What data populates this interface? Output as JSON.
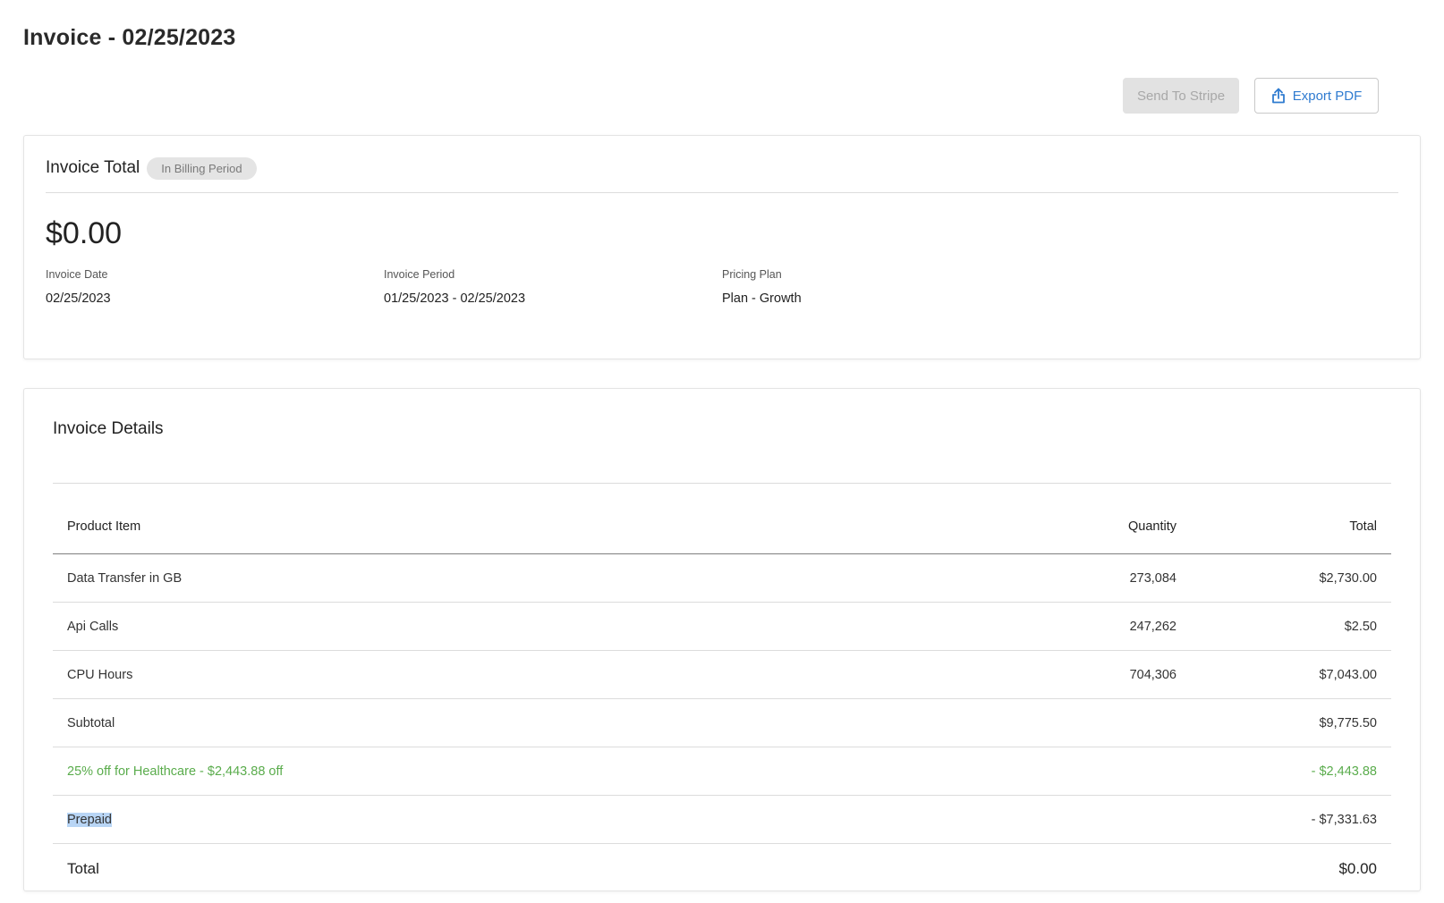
{
  "page": {
    "title": "Invoice - 02/25/2023"
  },
  "toolbar": {
    "send_label": "Send To Stripe",
    "export_label": "Export PDF"
  },
  "summary": {
    "heading": "Invoice Total",
    "badge": "In Billing Period",
    "amount": "$0.00",
    "invoice_date_label": "Invoice Date",
    "invoice_date": "02/25/2023",
    "invoice_period_label": "Invoice Period",
    "invoice_period": "01/25/2023 - 02/25/2023",
    "pricing_plan_label": "Pricing Plan",
    "pricing_plan": "Plan - Growth"
  },
  "details": {
    "title": "Invoice Details",
    "columns": {
      "item": "Product Item",
      "quantity": "Quantity",
      "total": "Total"
    },
    "rows": [
      {
        "item": "Data Transfer in GB",
        "quantity": "273,084",
        "total": "$2,730.00"
      },
      {
        "item": "Api Calls",
        "quantity": "247,262",
        "total": "$2.50"
      },
      {
        "item": "CPU Hours",
        "quantity": "704,306",
        "total": "$7,043.00"
      }
    ],
    "subtotal_label": "Subtotal",
    "subtotal": "$9,775.50",
    "discount_label": "25% off for Healthcare - $2,443.88 off",
    "discount": "- $2,443.88",
    "prepaid_label": "Prepaid",
    "prepaid": "- $7,331.63",
    "total_label": "Total",
    "total": "$0.00"
  },
  "colors": {
    "accent": "#2f7bd0",
    "discount": "#5aac4c",
    "disabled_bg": "#e2e2e2"
  },
  "icons": {
    "export": "upload-icon"
  }
}
